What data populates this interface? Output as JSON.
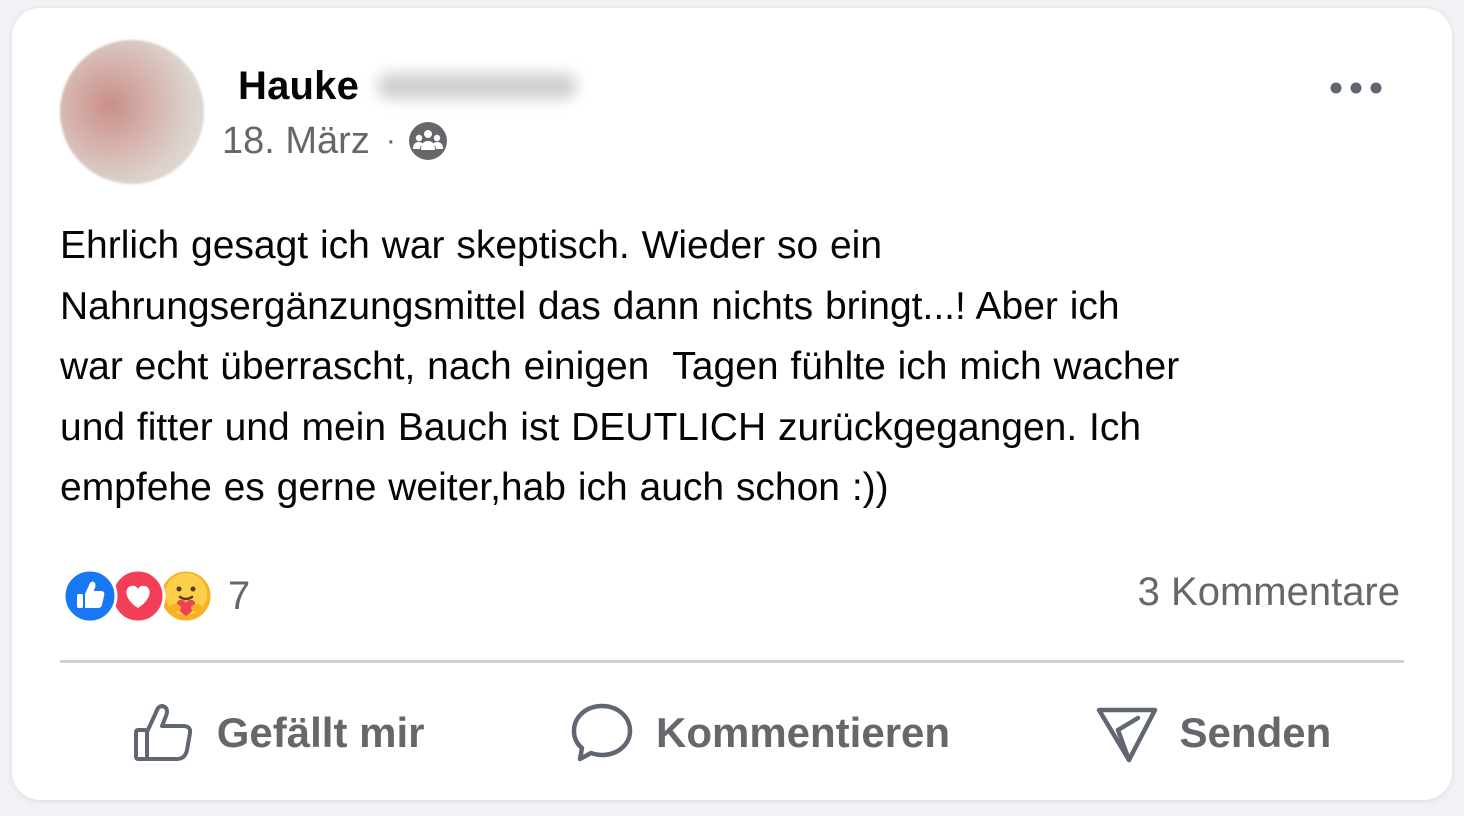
{
  "post": {
    "author_name": "Hauke",
    "date": "18. März",
    "separator": "·",
    "audience_icon": "friends-group-icon",
    "text": "Ehrlich gesagt ich war skeptisch. Wieder so ein\nNahrungsergänzungsmittel das dann nichts bringt...! Aber ich\nwar echt überrascht, nach einigen  Tagen fühlte ich mich wacher\nund fitter und mein Bauch ist DEUTLICH zurückgegangen. Ich\nempfehe es gerne weiter,hab ich auch schon :))"
  },
  "reactions": {
    "icons": [
      "like-icon",
      "love-icon",
      "care-icon"
    ],
    "count": "7"
  },
  "comments": {
    "label": "3 Kommentare"
  },
  "actions": {
    "like_label": "Gefällt mir",
    "comment_label": "Kommentieren",
    "share_label": "Senden"
  },
  "colors": {
    "like_blue": "#1877f2",
    "love_red": "#f33e58",
    "care_yellow": "#f7b125",
    "secondary_text": "#65676b"
  }
}
